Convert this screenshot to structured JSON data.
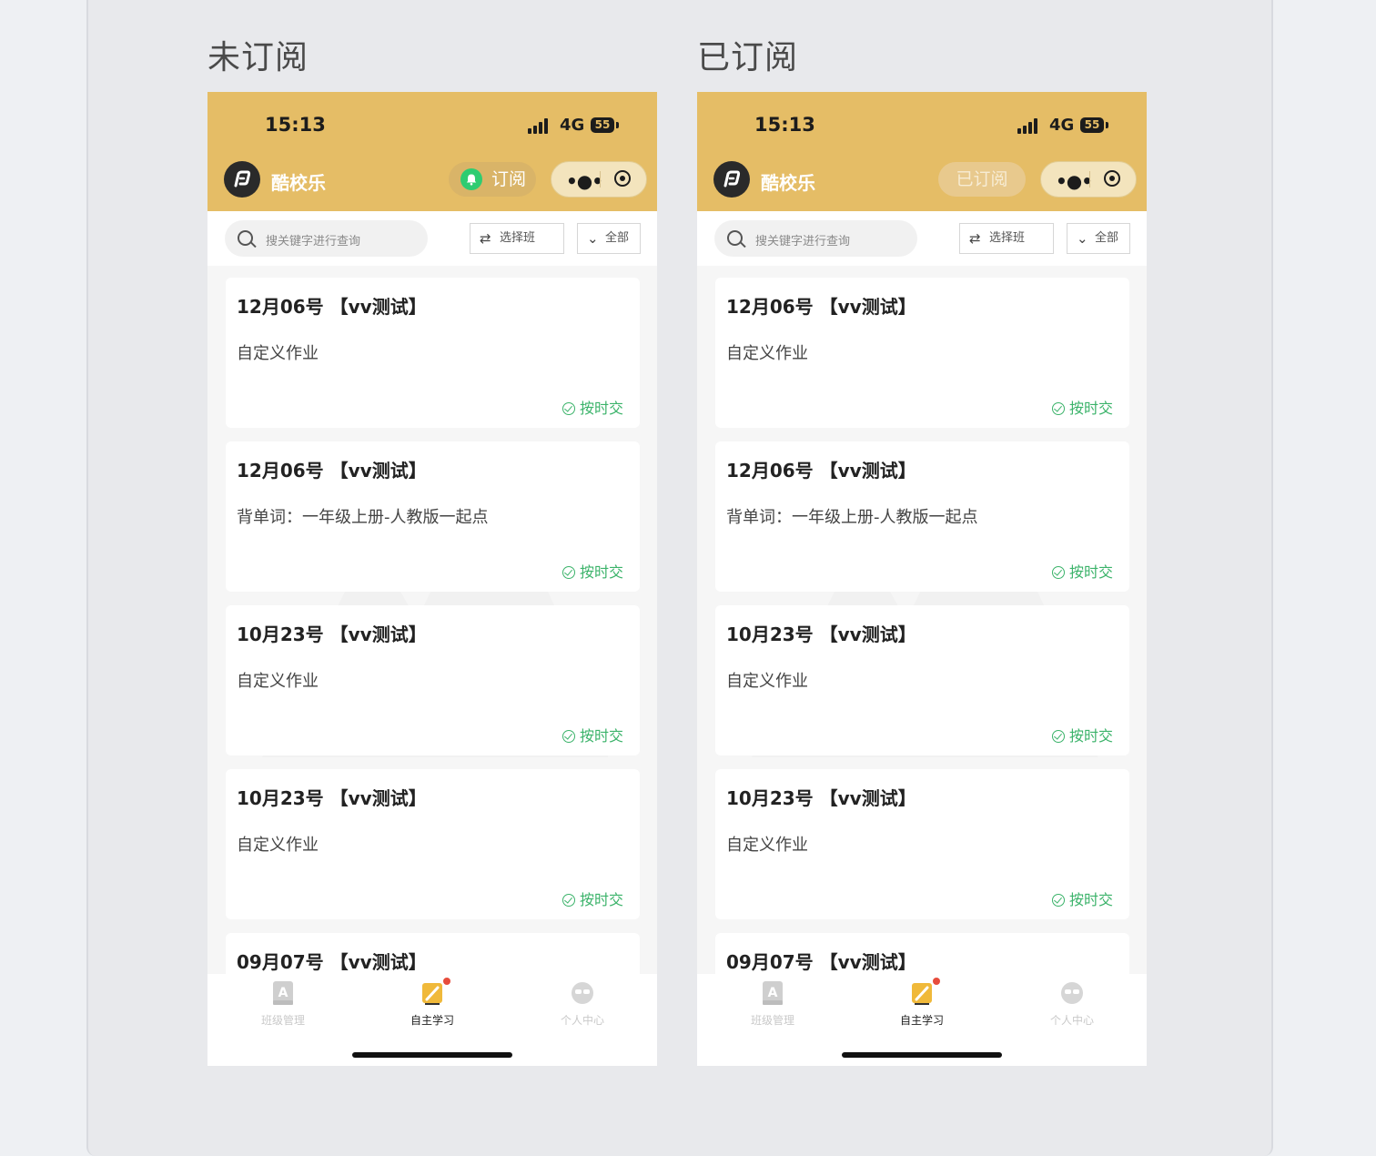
{
  "captions": {
    "left": "未订阅",
    "right": "已订阅"
  },
  "status_bar": {
    "time": "15:13",
    "network": "4G",
    "battery": "55"
  },
  "app": {
    "name": "酷校乐"
  },
  "subscribe_button": {
    "unsubscribed_label": "订阅",
    "subscribed_label": "已订阅"
  },
  "search": {
    "placeholder": "搜关键字进行查询"
  },
  "filters": {
    "class_label": "选择班",
    "range_label": "全部"
  },
  "cards": [
    {
      "title": "12月06号 【vv测试】",
      "desc": "自定义作业",
      "status": "按时交"
    },
    {
      "title": "12月06号 【vv测试】",
      "desc": "背单词：一年级上册-人教版一起点",
      "status": "按时交"
    },
    {
      "title": "10月23号 【vv测试】",
      "desc": "自定义作业",
      "status": "按时交"
    },
    {
      "title": "10月23号 【vv测试】",
      "desc": "自定义作业",
      "status": "按时交"
    },
    {
      "title": "09月07号 【vv测试】",
      "desc": "",
      "status": ""
    }
  ],
  "tabs": [
    {
      "label": "班级管理",
      "icon": "class-icon",
      "active": false
    },
    {
      "label": "自主学习",
      "icon": "study-icon",
      "active": true
    },
    {
      "label": "个人中心",
      "icon": "profile-icon",
      "active": false
    }
  ],
  "colors": {
    "header": "#e5bd66",
    "accent_green": "#3bb36a",
    "badge_red": "#e74c3c"
  }
}
